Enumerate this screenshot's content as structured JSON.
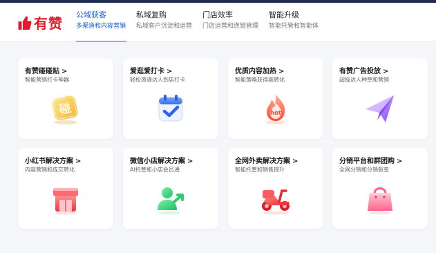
{
  "brand": {
    "name": "有赞",
    "color": "#e3192c"
  },
  "nav": {
    "tabs": [
      {
        "label": "公域获客",
        "sub": "多渠道和内容营销",
        "active": true
      },
      {
        "label": "私域复购",
        "sub": "私域客户沉淀和运营",
        "active": false
      },
      {
        "label": "门店效率",
        "sub": "门店运营和连锁管理",
        "active": false
      },
      {
        "label": "智能升级",
        "sub": "智能托管和智能体",
        "active": false
      }
    ],
    "accent": "#1e5bd8"
  },
  "cards": [
    {
      "title": "有赞碰碰贴",
      "sub": "智能营销打卡神器",
      "icon": "nfc-tag-icon",
      "icon_text": "碰"
    },
    {
      "title": "爱逛爱打卡",
      "sub": "轻松邀请达人到店打卡",
      "icon": "calendar-check-icon"
    },
    {
      "title": "优质内容加热",
      "sub": "智能策略获得高转化",
      "icon": "hot-flame-icon",
      "icon_text": "hot"
    },
    {
      "title": "有赞广告投放",
      "sub": "超级达人种草和营销",
      "icon": "paper-plane-icon"
    },
    {
      "title": "小红书解决方案",
      "sub": "内容营销和成交转化",
      "icon": "shop-icon"
    },
    {
      "title": "微信小店解决方案",
      "sub": "AI托管和小店会员通",
      "icon": "user-share-icon"
    },
    {
      "title": "全网外卖解决方案",
      "sub": "智能托管和销售提升",
      "icon": "scooter-icon"
    },
    {
      "title": "分销平台和群团购",
      "sub": "全网分销和分销裂变",
      "icon": "shopping-bag-icon"
    }
  ],
  "chevron": ">"
}
